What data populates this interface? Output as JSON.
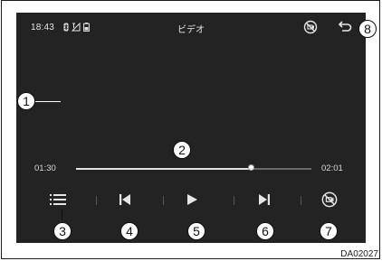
{
  "status_bar": {
    "time": "18:43",
    "status_icons": [
      "bluetooth-icon",
      "signal-icon",
      "battery-icon"
    ],
    "title": "ビデオ",
    "camera_off_icon": "camera-off-icon",
    "back_icon": "back-icon"
  },
  "playback": {
    "current_time": "01:30",
    "total_time": "02:01",
    "progress": 0.745
  },
  "controls": [
    {
      "name": "list-button",
      "icon": "list-icon"
    },
    {
      "name": "previous-button",
      "icon": "skip-previous-icon"
    },
    {
      "name": "play-button",
      "icon": "play-icon"
    },
    {
      "name": "next-button",
      "icon": "skip-next-icon"
    },
    {
      "name": "camera-off-button",
      "icon": "camera-off-icon"
    }
  ],
  "callouts": [
    "1",
    "2",
    "3",
    "4",
    "5",
    "6",
    "7",
    "8"
  ],
  "figure_code": "DA02027",
  "colors": {
    "screen_bg": "#232323",
    "text": "#e6e6e6",
    "track": "#6a6a6a",
    "track_fill": "#e2e2e2"
  }
}
